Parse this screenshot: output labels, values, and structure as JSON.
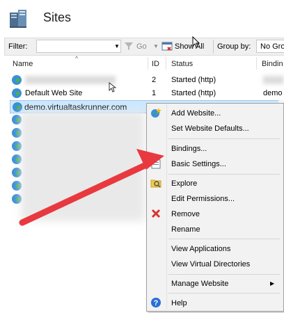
{
  "header": {
    "title": "Sites"
  },
  "toolbar": {
    "filter_label": "Filter:",
    "filter_value": "",
    "go_label": "Go",
    "show_all_label": "Show All",
    "group_by_label": "Group by:",
    "group_by_value": "No Gro"
  },
  "table": {
    "columns": [
      "Name",
      "ID",
      "Status",
      "Bindin"
    ],
    "rows": [
      {
        "name": "",
        "id": "2",
        "status": "Started (http)",
        "binding": ""
      },
      {
        "name": "Default Web Site",
        "id": "1",
        "status": "Started (http)",
        "binding": "demo"
      },
      {
        "name": "demo.virtualtaskrunner.com",
        "id": "",
        "status": "",
        "binding": ""
      }
    ]
  },
  "context_menu": {
    "items": [
      {
        "label": "Add Website...",
        "icon": "add-website-icon"
      },
      {
        "label": "Set Website Defaults...",
        "icon": ""
      },
      {
        "label": "Bindings...",
        "icon": ""
      },
      {
        "label": "Basic Settings...",
        "icon": "basic-settings-icon"
      },
      {
        "label": "Explore",
        "icon": "explore-folder-icon"
      },
      {
        "label": "Edit Permissions...",
        "icon": ""
      },
      {
        "label": "Remove",
        "icon": "remove-x-icon"
      },
      {
        "label": "Rename",
        "icon": ""
      },
      {
        "label": "View Applications",
        "icon": ""
      },
      {
        "label": "View Virtual Directories",
        "icon": ""
      },
      {
        "label": "Manage Website",
        "icon": "submenu-arrow-icon"
      },
      {
        "label": "Help",
        "icon": "help-icon"
      }
    ]
  },
  "colors": {
    "selection": "#cce8ff",
    "arrow": "#e8393f",
    "menu_bg": "#f2f2f2",
    "remove_x": "#d9342b",
    "help": "#2a6fd6"
  }
}
